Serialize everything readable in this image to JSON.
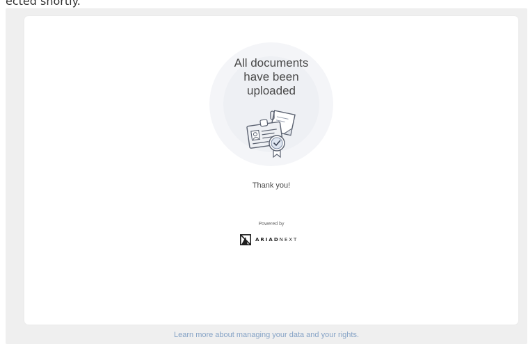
{
  "top_cropped_text": "ected shortly.",
  "card": {
    "headline": "All documents\nhave been\nuploaded",
    "thanks": "Thank you!",
    "powered_by": "Powered by",
    "brand": {
      "bold_part": "ARIAD",
      "light_part": "NEXT",
      "logo_icon": "ariadnext-logo-icon"
    },
    "illustration_icon": "documents-verified-icon"
  },
  "footer": {
    "link_text": "Learn more about managing your data and your rights."
  },
  "colors": {
    "page_bg": "#efefef",
    "card_bg": "#ffffff",
    "link": "#86a3c6",
    "text": "#4a4a4a"
  }
}
